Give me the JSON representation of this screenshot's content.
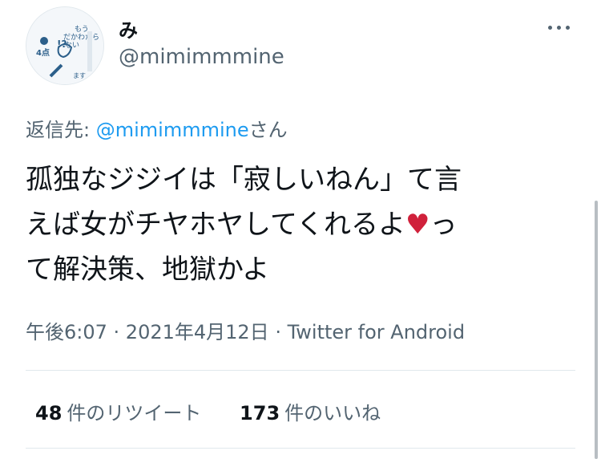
{
  "author": {
    "display_name": "み",
    "handle": "@mimimmmine"
  },
  "reply": {
    "prefix": "返信先: ",
    "mention": "@mimimmmine",
    "suffix": "さん"
  },
  "tweet": {
    "line1": "孤独なジジイは「寂しいねん」て言",
    "line2a": "えば女がチヤホヤしてくれるよ",
    "heart": "♥",
    "line2b": "っ",
    "line3": "て解決策、地獄かよ"
  },
  "meta": {
    "time": "午後6:07",
    "sep1": " · ",
    "date": "2021年4月12日",
    "sep2": " · ",
    "source": "Twitter for Android"
  },
  "stats": {
    "retweets_count": "48",
    "retweets_label": "件のリツイート",
    "likes_count": "173",
    "likes_label": "件のいいね"
  },
  "icons": {
    "more": "more-horizontal-icon",
    "avatar": "avatar-image"
  }
}
